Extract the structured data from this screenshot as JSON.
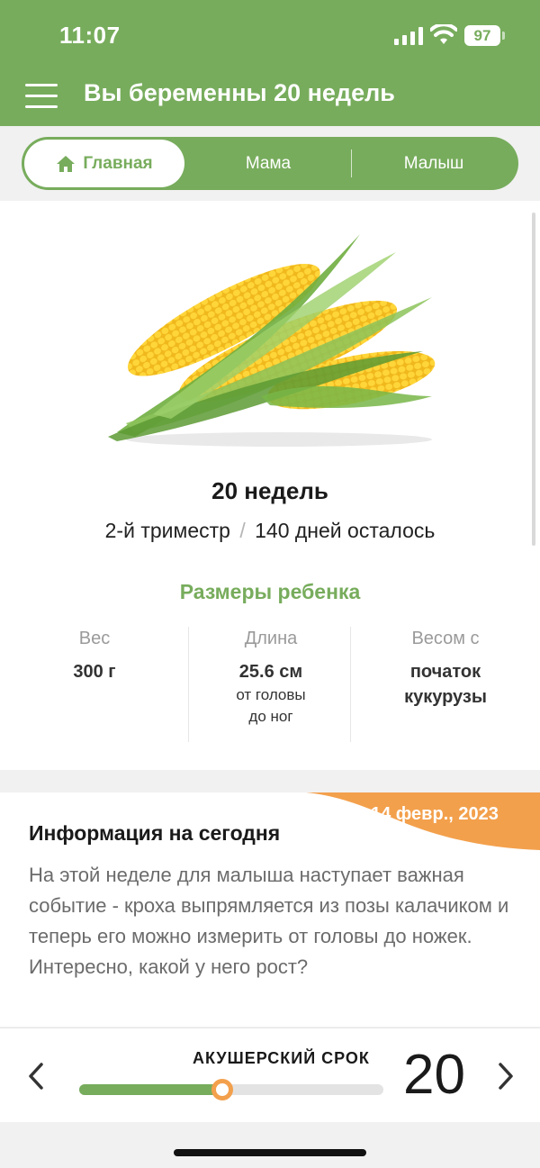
{
  "status_bar": {
    "time": "11:07",
    "battery": "97"
  },
  "header": {
    "title": "Вы беременны 20 недель"
  },
  "tabs": {
    "home_label": "Главная",
    "mom_label": "Мама",
    "baby_label": "Малыш"
  },
  "hero": {
    "image_icon": "corn-illustration",
    "week_title": "20 недель",
    "trimester": "2-й триместр",
    "separator": "/",
    "days_left": "140 дней осталось"
  },
  "sizes": {
    "title": "Размеры ребенка",
    "weight": {
      "label": "Вес",
      "value": "300 г"
    },
    "length": {
      "label": "Длина",
      "value": "25.6 см",
      "note_line1": "от головы",
      "note_line2": "до ног"
    },
    "compare": {
      "label": "Весом с",
      "value_line1": "початок",
      "value_line2": "кукурузы"
    }
  },
  "info": {
    "date": "14 февр., 2023",
    "title": "Информация на сегодня",
    "text": "На этой неделе для малыша наступает важная событие - кроха выпрямляется из позы калачиком и теперь его можно измерить от головы до ножек. Интересно, какой у него рост?"
  },
  "term": {
    "label": "АКУШЕРСКИЙ СРОК",
    "week": "20",
    "progress": 0.47
  },
  "colors": {
    "brand_green": "#77ac5c",
    "accent_orange": "#f3a04c",
    "muted_text": "#6b6b6b"
  }
}
